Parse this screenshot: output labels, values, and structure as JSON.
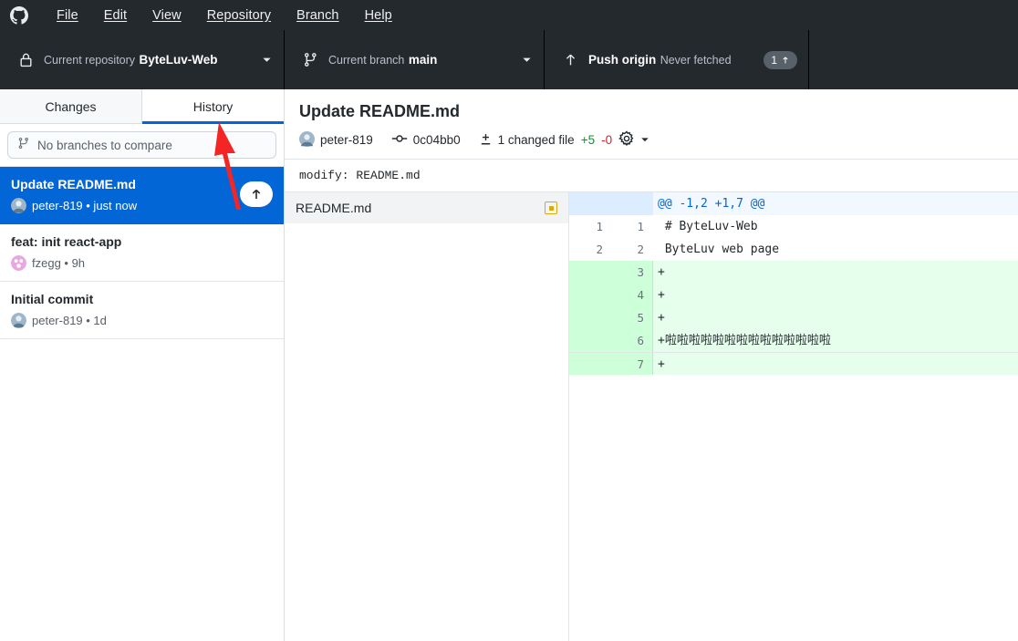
{
  "menubar": {
    "logo_icon": "github-logo-icon",
    "items": [
      {
        "label": "File",
        "accel": "F"
      },
      {
        "label": "Edit",
        "accel": "E"
      },
      {
        "label": "View",
        "accel": "V"
      },
      {
        "label": "Repository",
        "accel": "R"
      },
      {
        "label": "Branch",
        "accel": "B"
      },
      {
        "label": "Help",
        "accel": "H"
      }
    ]
  },
  "toolbar": {
    "repository": {
      "icon": "lock-icon",
      "label": "Current repository",
      "value": "ByteLuv-Web",
      "caret": "chevron-down-icon"
    },
    "branch": {
      "icon": "git-branch-icon",
      "label": "Current branch",
      "value": "main",
      "caret": "chevron-down-icon"
    },
    "push": {
      "icon": "arrow-up-icon",
      "label": "Push origin",
      "value": "Never fetched",
      "badge_count": "1",
      "badge_icon": "arrow-up-icon"
    }
  },
  "sidebar": {
    "tabs": [
      {
        "label": "Changes",
        "active": false
      },
      {
        "label": "History",
        "active": true
      }
    ],
    "compare": {
      "icon": "git-branch-icon",
      "placeholder": "No branches to compare"
    },
    "commits": [
      {
        "title": "Update README.md",
        "byline": "peter-819 • just now",
        "selected": true,
        "push_icon": "arrow-up-icon"
      },
      {
        "title": "feat: init react-app",
        "byline": "fzegg • 9h",
        "selected": false
      },
      {
        "title": "Initial commit",
        "byline": "peter-819 • 1d",
        "selected": false
      }
    ]
  },
  "main": {
    "commit": {
      "title": "Update README.md",
      "author": "peter-819",
      "sha_icon": "git-commit-icon",
      "sha": "0c04bb0",
      "changed_icon": "diff-icon",
      "changed_files": "1 changed file",
      "additions": "+5",
      "deletions": "-0",
      "settings_icon": "gear-icon",
      "settings_caret": "chevron-down-icon"
    },
    "summary": "modify: README.md",
    "file": {
      "name": "README.md",
      "status_icon": "modified-square-icon"
    },
    "diff": {
      "hunk_header": "@@ -1,2 +1,7 @@",
      "lines": [
        {
          "kind": "hunk",
          "old": "",
          "new": "",
          "text": "@@ -1,2 +1,7 @@"
        },
        {
          "kind": "ctx",
          "old": "1",
          "new": "1",
          "text": " # ByteLuv-Web",
          "highlight": "md-heading"
        },
        {
          "kind": "ctx",
          "old": "2",
          "new": "2",
          "text": " ByteLuv web page"
        },
        {
          "kind": "add",
          "old": "",
          "new": "3",
          "text": "+"
        },
        {
          "kind": "add",
          "old": "",
          "new": "4",
          "text": "+"
        },
        {
          "kind": "add",
          "old": "",
          "new": "5",
          "text": "+"
        },
        {
          "kind": "add",
          "old": "",
          "new": "6",
          "text": "+啦啦啦啦啦啦啦啦啦啦啦啦啦啦"
        },
        {
          "kind": "add",
          "old": "",
          "new": "7",
          "text": "+"
        }
      ]
    }
  },
  "annotation": {
    "arrow_icon": "red-arrow-up-icon",
    "color": "#f42525"
  },
  "colors": {
    "toolbar_bg": "#24292e",
    "accent_blue": "#0366d6",
    "add_bg": "#e6ffec",
    "add_gutter": "#cdffd8",
    "hunk_bg": "#f1f8ff",
    "addition_green": "#22863a",
    "deletion_red": "#cb2431",
    "modified_yellow": "#dbab09"
  }
}
